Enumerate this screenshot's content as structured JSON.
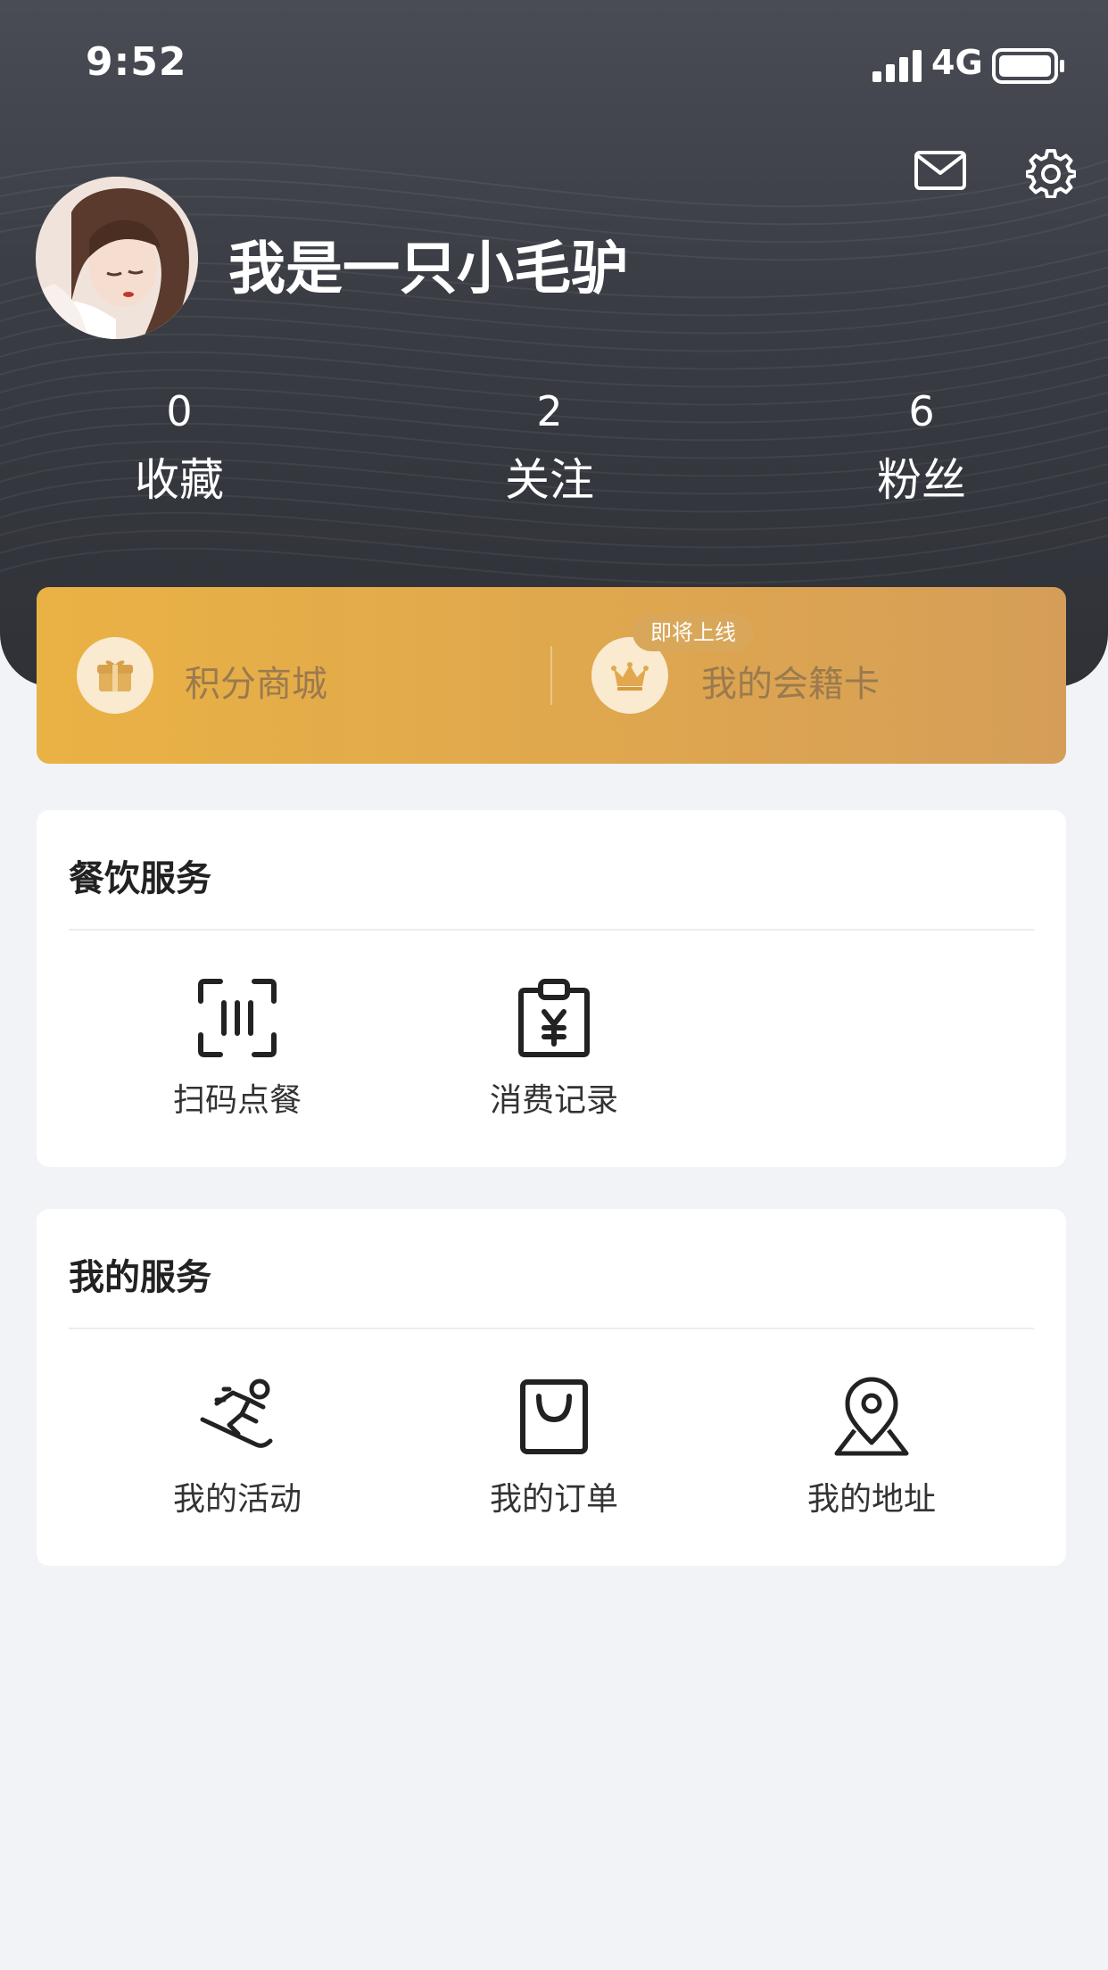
{
  "status_bar": {
    "time": "9:52",
    "network": "4G"
  },
  "profile": {
    "username": "我是一只小毛驴",
    "stats": [
      {
        "value": "0",
        "label": "收藏"
      },
      {
        "value": "2",
        "label": "关注"
      },
      {
        "value": "6",
        "label": "粉丝"
      }
    ]
  },
  "gold_banner": {
    "points_mall": "积分商城",
    "membership_card": "我的会籍卡",
    "coming_soon_badge": "即将上线"
  },
  "dining_services": {
    "title": "餐饮服务",
    "items": [
      {
        "label": "扫码点餐",
        "icon": "scan-code-icon"
      },
      {
        "label": "消费记录",
        "icon": "receipt-yen-icon"
      }
    ]
  },
  "my_services": {
    "title": "我的服务",
    "items": [
      {
        "label": "我的活动",
        "icon": "skiing-person-icon"
      },
      {
        "label": "我的订单",
        "icon": "shopping-bag-icon"
      },
      {
        "label": "我的地址",
        "icon": "location-pin-icon"
      }
    ]
  },
  "colors": {
    "header_dark": "#3a3c44",
    "gold_start": "#eab244",
    "gold_end": "#d59e58",
    "page_bg": "#f2f3f7"
  }
}
